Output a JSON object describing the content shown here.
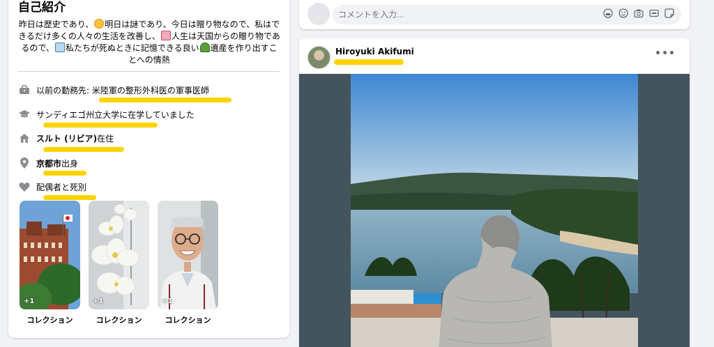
{
  "intro": {
    "title": "自己紹介",
    "bio": {
      "p1": "昨日は歴史であり、",
      "p2": "明日は謎であり、今日は贈り物なので、私はできるだけ多くの人々の生活を改善し、",
      "p3": "人生は天国からの贈り物であるので、",
      "p4": "私たちが死ぬときに記憶できる良い",
      "p5": "遺産を作り出すことへの情熱"
    },
    "details": [
      {
        "icon": "briefcase-icon",
        "text": "以前の勤務先: 米陸軍の整形外科医の軍事医師"
      },
      {
        "icon": "graduation-cap-icon",
        "text": "サンディエゴ州立大学に在学していました"
      },
      {
        "icon": "home-icon",
        "bold": "スルト (リビア)",
        "text": "在住"
      },
      {
        "icon": "location-pin-icon",
        "bold": "京都市",
        "text": "出身"
      },
      {
        "icon": "heart-icon",
        "text": "配偶者と死別"
      }
    ],
    "collections": [
      {
        "label": "コレクション",
        "badge": "+1"
      },
      {
        "label": "コレクション",
        "badge": "+1"
      },
      {
        "label": "コレクション",
        "badge": "+1"
      }
    ]
  },
  "comment": {
    "placeholder": "コメントを入力..."
  },
  "post": {
    "author": "Hiroyuki Akifumi",
    "more": "•••"
  },
  "colors": {
    "highlight": "#ffd400",
    "background": "#f0f2f5",
    "media_bg": "#44545d"
  }
}
